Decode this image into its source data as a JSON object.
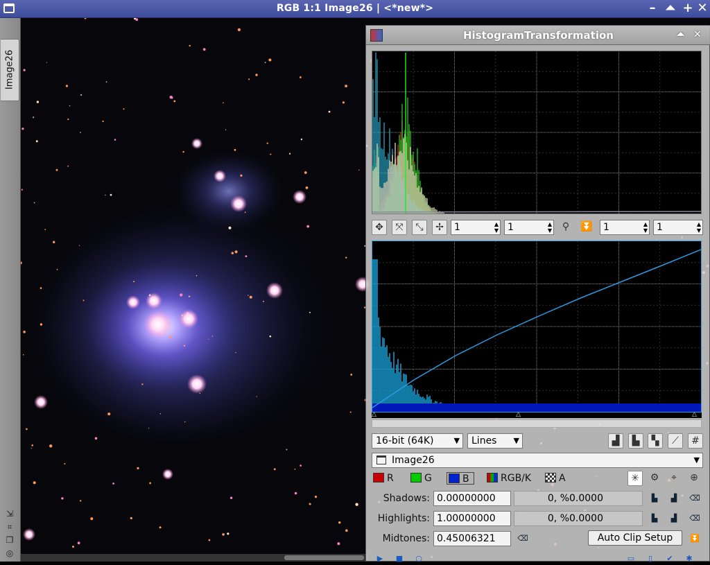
{
  "window": {
    "title": "RGB 1:1 Image26 | <*new*>"
  },
  "view_tab": {
    "label": "Image26"
  },
  "panel": {
    "title": "HistogramTransformation",
    "zoom_fields": [
      "1",
      "1",
      "1",
      "1"
    ],
    "resolution": "16-bit (64K)",
    "graph_style": "Lines",
    "view": "Image26",
    "channels": [
      {
        "label": "R",
        "color": "#cc0000"
      },
      {
        "label": "G",
        "color": "#00cc00"
      },
      {
        "label": "B",
        "color": "#0022cc"
      },
      {
        "label": "RGB/K",
        "color": "multi"
      },
      {
        "label": "A",
        "color": "checker"
      }
    ],
    "shadows": {
      "label": "Shadows:",
      "value": "0.00000000",
      "clip": "0, %0.0000"
    },
    "highlights": {
      "label": "Highlights:",
      "value": "1.00000000",
      "clip": "0, %0.0000"
    },
    "midtones": {
      "label": "Midtones:",
      "value": "0.45006321"
    },
    "auto_clip_label": "Auto Clip Setup"
  }
}
